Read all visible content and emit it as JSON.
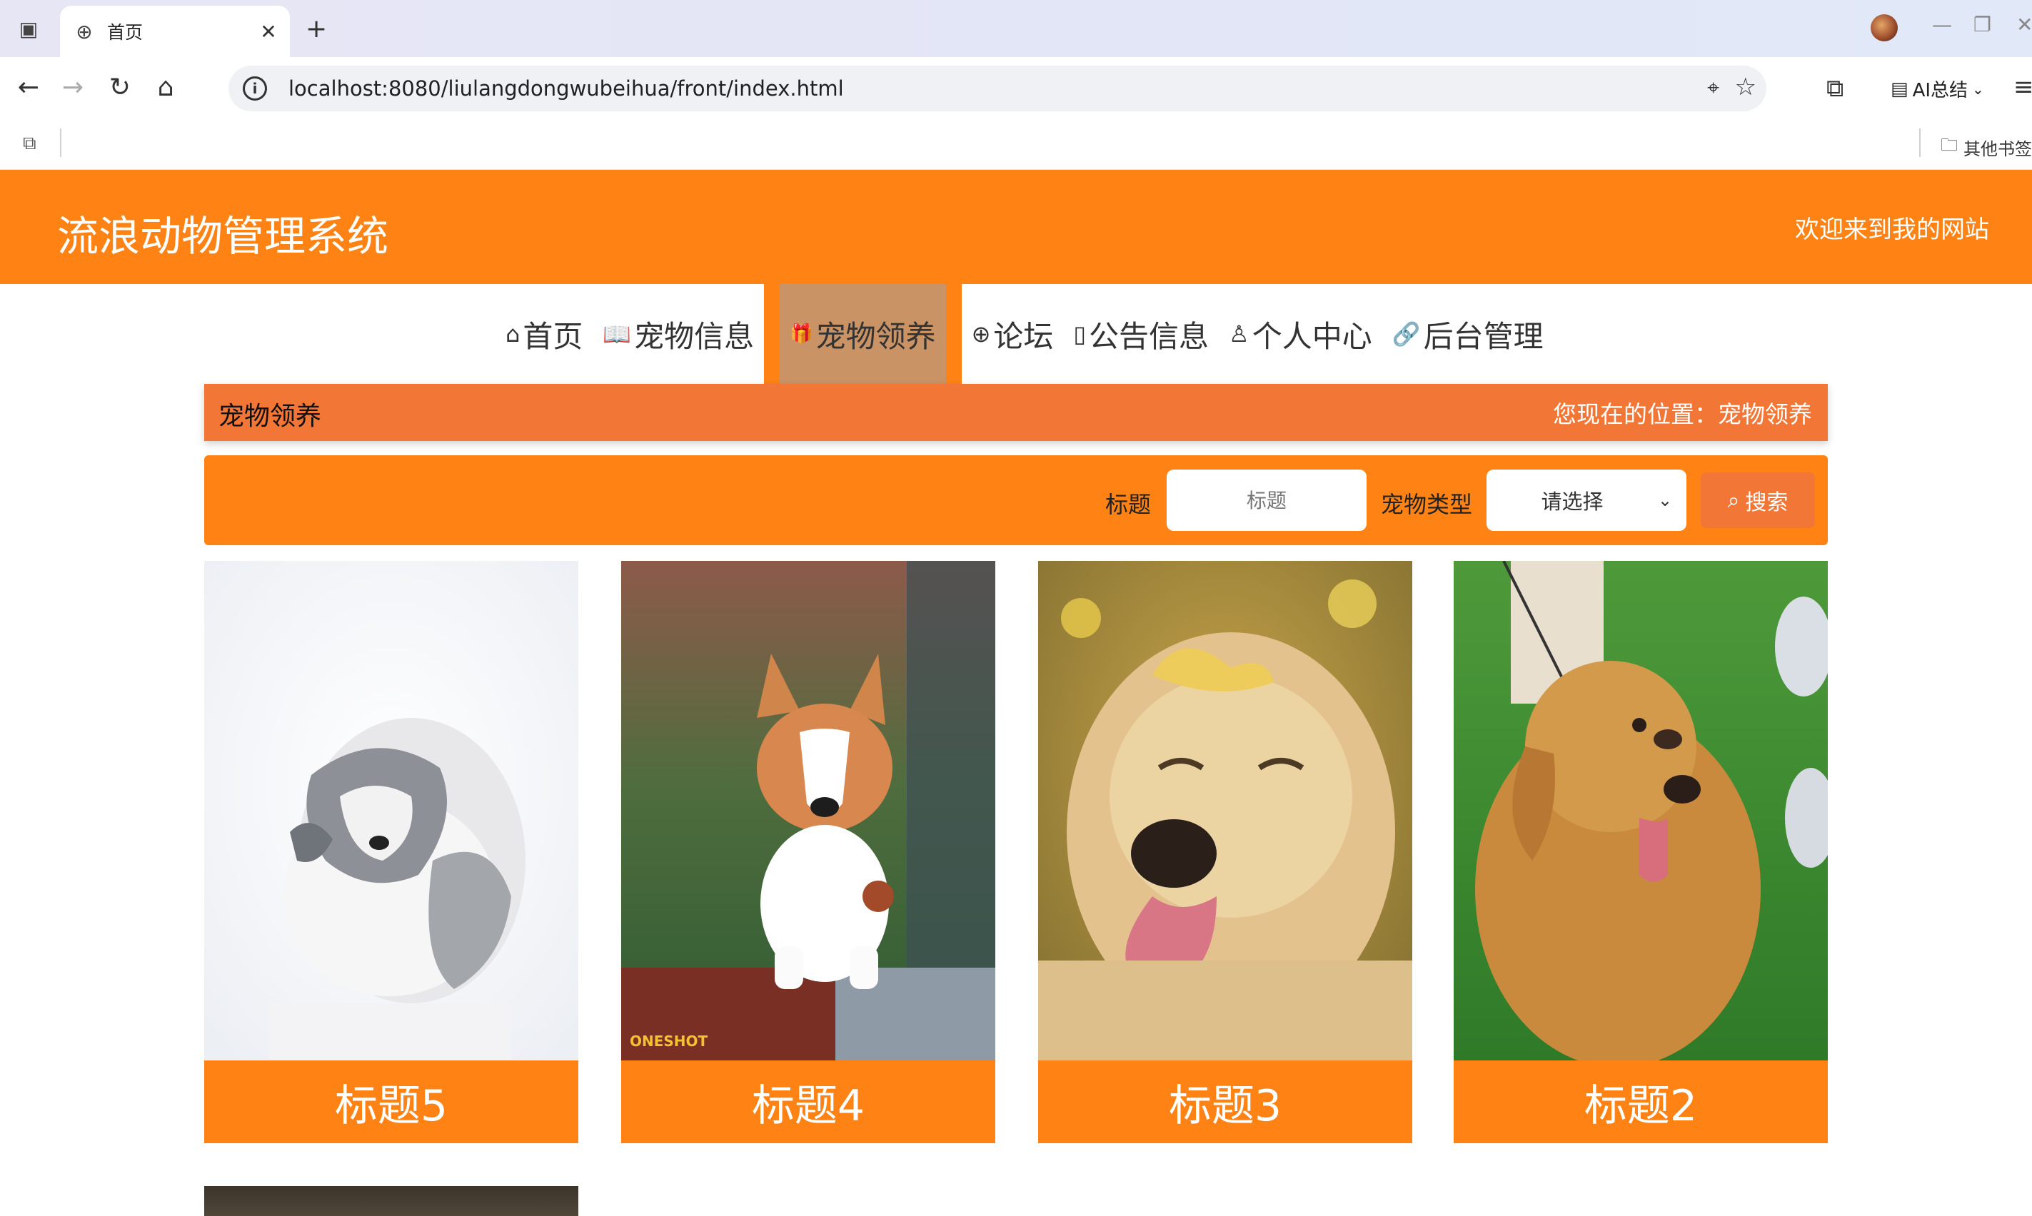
{
  "browser": {
    "tab_title": "首页",
    "url": "localhost:8080/liulangdongwubeihua/front/index.html",
    "ai_summary_label": "AI总结",
    "other_bookmarks_label": "其他书签"
  },
  "site": {
    "title": "流浪动物管理系统",
    "welcome": "欢迎来到我的网站"
  },
  "nav": {
    "items": [
      {
        "label": "首页",
        "icon": "home-icon"
      },
      {
        "label": "宠物信息",
        "icon": "book-icon"
      },
      {
        "label": "宠物领养",
        "icon": "gift-icon",
        "active": true
      },
      {
        "label": "论坛",
        "icon": "globe-icon"
      },
      {
        "label": "公告信息",
        "icon": "note-icon"
      },
      {
        "label": "个人中心",
        "icon": "user-icon"
      },
      {
        "label": "后台管理",
        "icon": "link-icon"
      }
    ]
  },
  "breadcrumb": {
    "title": "宠物领养",
    "location": "您现在的位置：宠物领养"
  },
  "search": {
    "title_label": "标题",
    "title_placeholder": "标题",
    "type_label": "宠物类型",
    "type_selected": "请选择",
    "button_label": "搜索"
  },
  "cards": [
    {
      "caption": "标题5",
      "photo": "grey-white-dog"
    },
    {
      "caption": "标题4",
      "photo": "corgi",
      "watermark": "ONESHOT"
    },
    {
      "caption": "标题3",
      "photo": "golden-retriever-with-leaf"
    },
    {
      "caption": "标题2",
      "photo": "golden-retriever-on-grass"
    }
  ],
  "colors": {
    "header_orange": "#fe8314",
    "breadcrumb_orange": "#f27636",
    "active_nav": "#c99366"
  }
}
